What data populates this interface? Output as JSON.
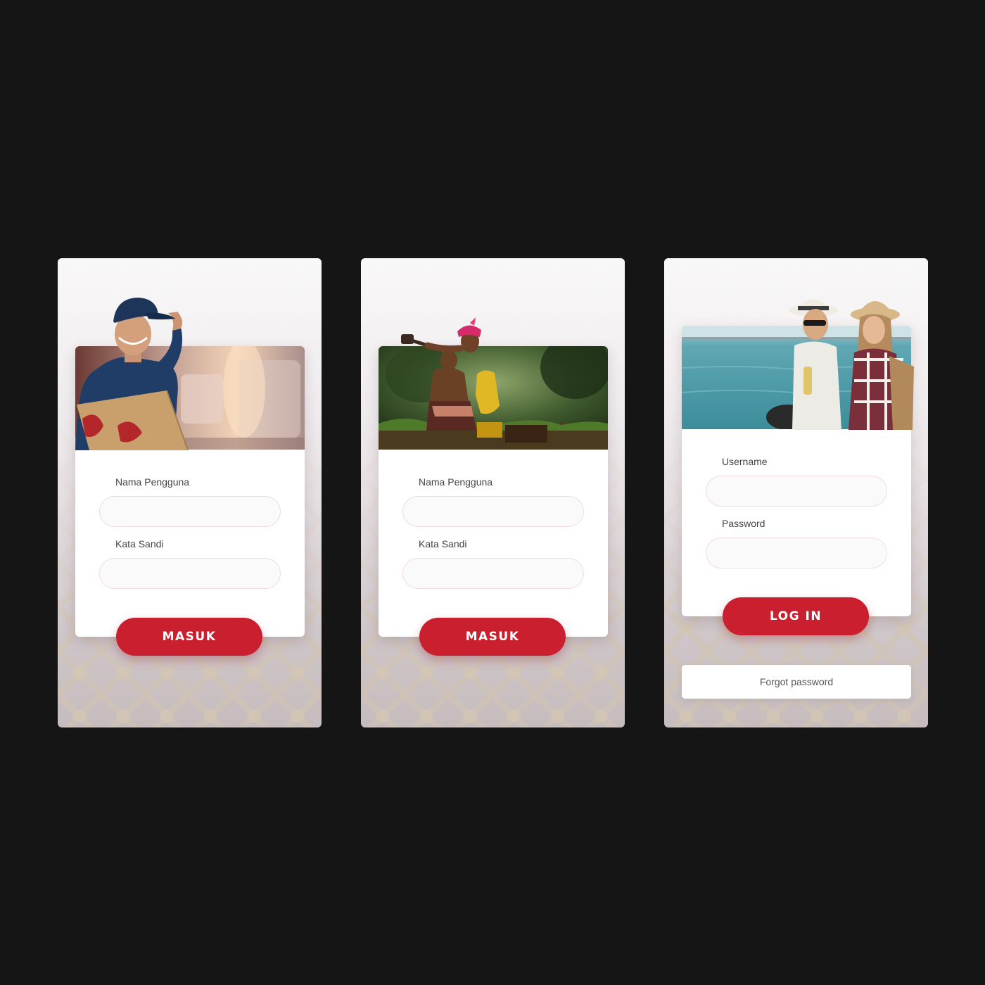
{
  "screens": [
    {
      "username_label": "Nama Pengguna",
      "username_value": "",
      "password_label": "Kata Sandi",
      "password_value": "",
      "submit_label": "MASUK"
    },
    {
      "username_label": "Nama Pengguna",
      "username_value": "",
      "password_label": "Kata Sandi",
      "password_value": "",
      "submit_label": "MASUK"
    },
    {
      "username_label": "Username",
      "username_value": "",
      "password_label": "Password",
      "password_value": "",
      "submit_label": "LOG IN",
      "forgot_label": "Forgot password"
    }
  ],
  "colors": {
    "page_background": "#151515",
    "accent": "#c91f2e",
    "card": "#ffffff",
    "input_border": "#f3d9dd"
  }
}
